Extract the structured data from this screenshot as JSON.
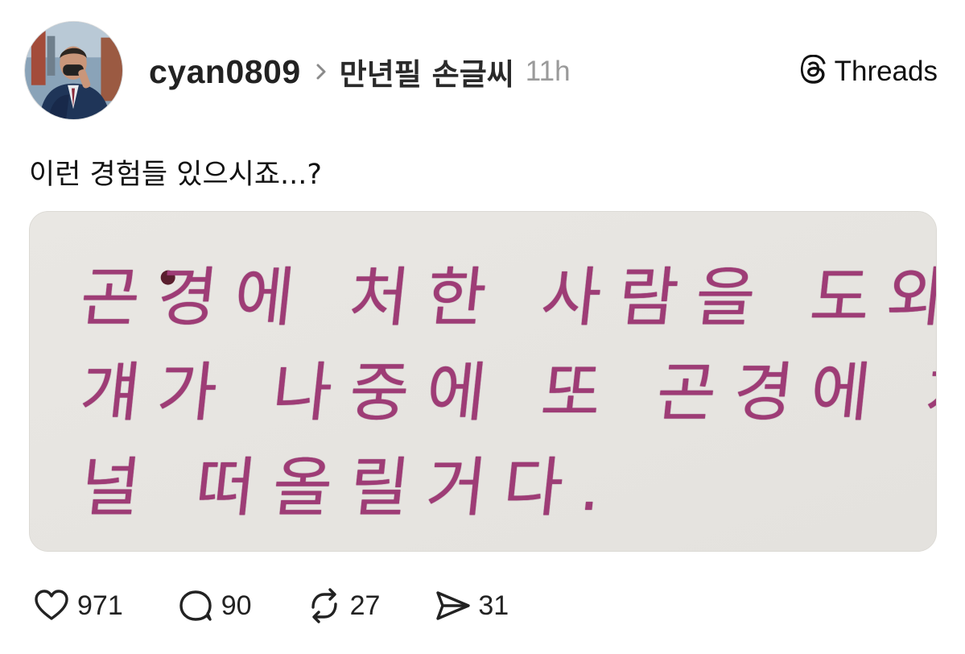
{
  "post": {
    "username": "cyan0809",
    "topic": "만년필 손글씨",
    "time": "11h",
    "text": "이런 경험들 있으시죠...?",
    "image_lines": [
      "곤경에 처한 사람을 도와주면",
      "걔가 나중에 또 곤경에 처했을때",
      "널 떠올릴거다."
    ]
  },
  "brand": {
    "label": "Threads",
    "icon": "threads-logo-icon"
  },
  "actions": {
    "likes": "971",
    "replies": "90",
    "reposts": "27",
    "shares": "31"
  },
  "colors": {
    "ink": "#9e3c76",
    "card_bg": "#e8e6e2",
    "time_gray": "#9a9a9a"
  }
}
